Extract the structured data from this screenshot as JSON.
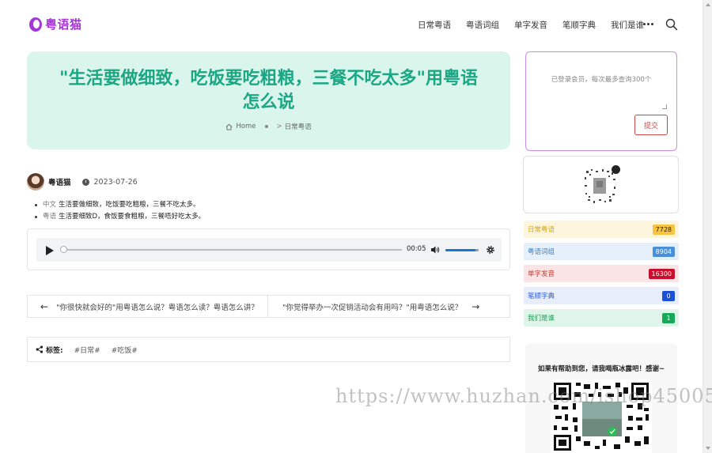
{
  "header": {
    "logo_text": "粤语猫",
    "nav": [
      "日常粤语",
      "粤语词组",
      "单字发音",
      "笔顺字典",
      "我们是谁"
    ]
  },
  "hero": {
    "title": "\"生活要做细致，吃饭要吃粗粮，三餐不吃太多\"用粤语怎么说",
    "breadcrumb_home": "Home",
    "breadcrumb_sep": ">",
    "breadcrumb_current": "日常粤语"
  },
  "author": {
    "name": "粤语猫",
    "date": "2023-07-26"
  },
  "content": [
    {
      "lang": "中文",
      "text": "生活要做细致，吃饭要吃粗粮，三餐不吃太多。"
    },
    {
      "lang": "粤语",
      "text": "生活要细致D，食饭要食粗粮，三餐唔好吃太多。"
    }
  ],
  "audio": {
    "time": "00:05",
    "volume": 0.9,
    "progress": 0.0
  },
  "prev_next": {
    "prev": "\"你很快就会好的\"用粤语怎么说？粤语怎么读？粤语怎么讲？",
    "next": "\"你觉得举办一次促销活动会有用吗？\"用粤语怎么说？"
  },
  "tags": {
    "label": "标签:",
    "items": [
      "#日常#",
      "#吃饭#"
    ]
  },
  "sidebar": {
    "query_placeholder": "已登录会员，每次最多查询300个",
    "submit_label": "提交",
    "categories": [
      {
        "name": "日常粤语",
        "count": "7728",
        "bg": "#fdf5dc",
        "text": "#e0a100",
        "badge_bg": "#f6c343",
        "badge_text": "#222"
      },
      {
        "name": "粤语词组",
        "count": "8904",
        "bg": "#e6f0fb",
        "text": "#3b82c4",
        "badge_bg": "#4a90d9",
        "badge_text": "#fff"
      },
      {
        "name": "单字发音",
        "count": "16300",
        "bg": "#fbe4e6",
        "text": "#c0392b",
        "badge_bg": "#c8102e",
        "badge_text": "#fff"
      },
      {
        "name": "笔顺字典",
        "count": "0",
        "bg": "#e8edfb",
        "text": "#2a5bd7",
        "badge_bg": "#1a4fd6",
        "badge_text": "#fff"
      },
      {
        "name": "我们是谁",
        "count": "1",
        "bg": "#e0f5ea",
        "text": "#1f9d55",
        "badge_bg": "#18a957",
        "badge_text": "#fff"
      }
    ],
    "donate_text": "如果有帮助到您，请我喝瓶冰露吧！感谢~"
  },
  "watermark": "https://www.huzhan.com/ishop45005"
}
